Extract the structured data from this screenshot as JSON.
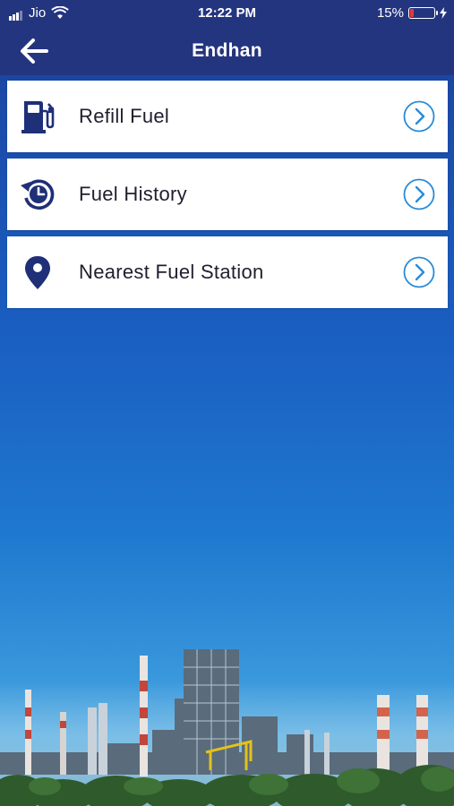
{
  "status_bar": {
    "carrier": "Jio",
    "time": "12:22 PM",
    "battery_percent": "15%",
    "battery_level": 0.15,
    "battery_color": "#e53935"
  },
  "nav": {
    "title": "Endhan",
    "back_icon": "arrow-left-icon"
  },
  "menu": {
    "items": [
      {
        "label": "Refill Fuel",
        "icon": "fuel-pump-icon"
      },
      {
        "label": "Fuel History",
        "icon": "history-clock-icon"
      },
      {
        "label": "Nearest Fuel Station",
        "icon": "map-pin-icon"
      }
    ],
    "chevron_icon": "chevron-right-circle-icon"
  },
  "colors": {
    "navbar": "#24357f",
    "icon": "#1f2f78",
    "chevron": "#2a8ad6",
    "card": "#ffffff"
  },
  "background_image": "refinery-skyline"
}
